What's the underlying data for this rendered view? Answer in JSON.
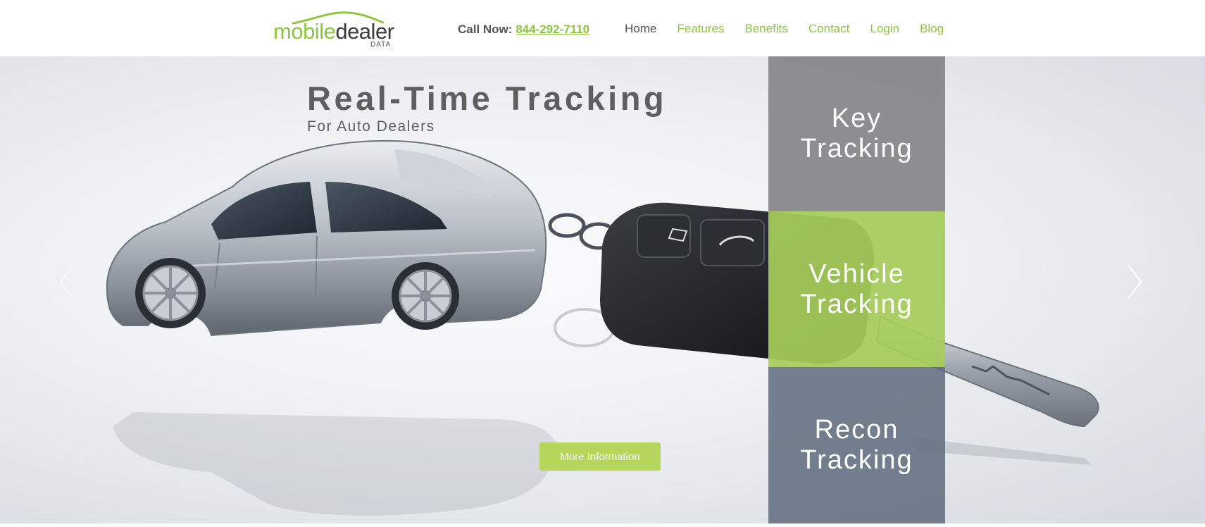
{
  "header": {
    "logo": {
      "word_mobile": "mobile",
      "word_dealer": "dealer",
      "sub": "DATA"
    },
    "call_label": "Call Now:",
    "phone": "844-292-7110",
    "nav": [
      {
        "label": "Home",
        "active": true
      },
      {
        "label": "Features",
        "active": false
      },
      {
        "label": "Benefits",
        "active": false
      },
      {
        "label": "Contact",
        "active": false
      },
      {
        "label": "Login",
        "active": false
      },
      {
        "label": "Blog",
        "active": false
      }
    ]
  },
  "hero": {
    "title": "Real-Time Tracking",
    "subtitle": "For Auto Dealers",
    "button_label": "More Information",
    "tiles": [
      {
        "line1": "Key",
        "line2": "Tracking",
        "color": "#89898c"
      },
      {
        "line1": "Vehicle",
        "line2": "Tracking",
        "color": "#a6cc5a"
      },
      {
        "line1": "Recon",
        "line2": "Tracking",
        "color": "#626e80"
      }
    ],
    "arrows": {
      "left": "chevron-left-icon",
      "right": "chevron-right-icon"
    }
  },
  "colors": {
    "accent_green": "#8dc63f",
    "button_green": "#b5d65a",
    "text_gray": "#555555"
  }
}
